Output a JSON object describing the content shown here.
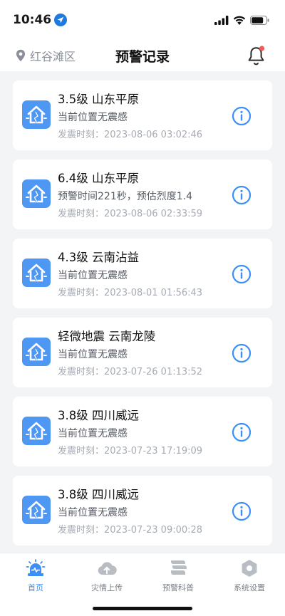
{
  "status_bar": {
    "time": "10:46"
  },
  "header": {
    "location": "红谷滩区",
    "title": "预警记录"
  },
  "records": [
    {
      "title": "3.5级 山东平原",
      "subtitle": "当前位置无震感",
      "time": "发震时刻：2023-08-06 03:02:46"
    },
    {
      "title": "6.4级 山东平原",
      "subtitle": "预警时间221秒，预估烈度1.4",
      "time": "发震时刻：2023-08-06 02:33:59"
    },
    {
      "title": "4.3级 云南沾益",
      "subtitle": "当前位置无震感",
      "time": "发震时刻：2023-08-01 01:56:43"
    },
    {
      "title": "轻微地震 云南龙陵",
      "subtitle": "当前位置无震感",
      "time": "发震时刻：2023-07-26 01:13:52"
    },
    {
      "title": "3.8级 四川威远",
      "subtitle": "当前位置无震感",
      "time": "发震时刻：2023-07-23 17:19:09"
    },
    {
      "title": "3.8级 四川威远",
      "subtitle": "当前位置无震感",
      "time": "发震时刻：2023-07-23 09:00:28"
    }
  ],
  "tabs": [
    {
      "label": "首页",
      "icon": "alarm-icon",
      "active": true
    },
    {
      "label": "灾情上传",
      "icon": "cloud-upload-icon",
      "active": false
    },
    {
      "label": "预警科普",
      "icon": "book-icon",
      "active": false
    },
    {
      "label": "系统设置",
      "icon": "settings-hexagon-icon",
      "active": false
    }
  ],
  "colors": {
    "accent": "#3b8ff6",
    "card_icon": "#4e97f2",
    "notification_dot": "#f05a5a",
    "background": "#f3f4f6"
  }
}
